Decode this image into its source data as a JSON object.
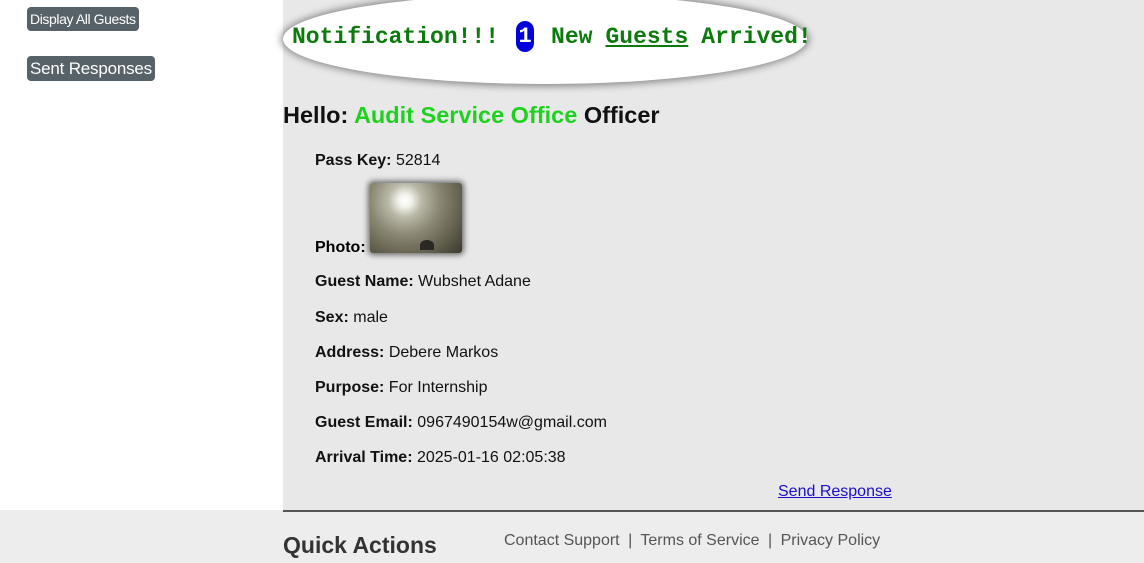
{
  "sidebar": {
    "display_all_guests": "Display All Guests",
    "sent_responses": "Sent Responses"
  },
  "notification": {
    "prefix": "Notification!!!",
    "count": "1",
    "new": "New",
    "guests_link": "Guests",
    "suffix": "Arrived!"
  },
  "greeting": {
    "hello": "Hello:",
    "office": "Audit Service Office",
    "role": "Officer"
  },
  "guest": {
    "pass_key_label": "Pass Key:",
    "pass_key": "52814",
    "photo_label": "Photo:",
    "name_label": "Guest Name:",
    "name": "Wubshet Adane",
    "sex_label": "Sex:",
    "sex": "male",
    "address_label": "Address:",
    "address": "Debere Markos",
    "purpose_label": "Purpose:",
    "purpose": "For Internship",
    "email_label": "Guest Email:",
    "email": "0967490154w@gmail.com",
    "arrival_label": "Arrival Time:",
    "arrival": "2025-01-16 02:05:38"
  },
  "send_response": "Send Response",
  "footer": {
    "quick_actions": "Quick Actions",
    "contact_support": "Contact Support",
    "terms": "Terms of Service",
    "privacy": "Privacy Policy",
    "separator": "|"
  },
  "colors": {
    "main_bg": "#e8e8e8",
    "notif_green": "#0c7a0c",
    "office_green": "#1fd11f",
    "count_badge": "#0000dd",
    "sidebar_button": "#566268",
    "link_blue": "#1a0dcc"
  },
  "icons": {
    "guest_photo": "guest-photo"
  }
}
